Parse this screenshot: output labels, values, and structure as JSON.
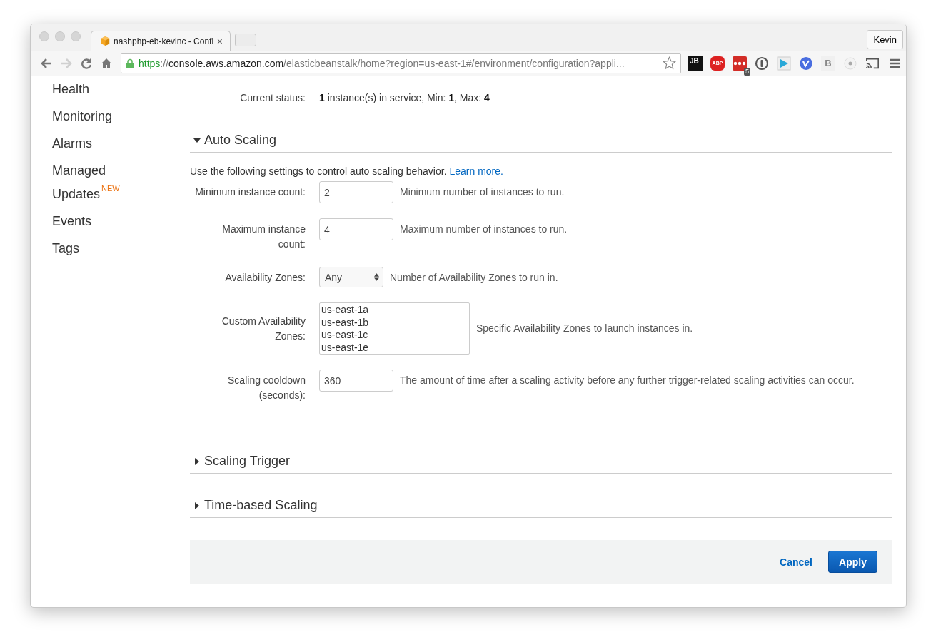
{
  "browser": {
    "tab": {
      "title": "nashphp-eb-kevinc - Confi",
      "close": "×"
    },
    "profile": "Kevin",
    "nav": [
      {
        "kind": "back",
        "disabled": false
      },
      {
        "kind": "forward",
        "disabled": true
      },
      {
        "kind": "reload",
        "disabled": false
      },
      {
        "kind": "home",
        "disabled": false
      }
    ],
    "url": {
      "scheme": "https",
      "sep": "://",
      "host": "console.aws.amazon.com",
      "path": "/elasticbeanstalk/home?region=us-east-1#/environment/configuration?appli..."
    },
    "extensions": [
      {
        "kind": "jb",
        "label": "JB"
      },
      {
        "kind": "abp",
        "label": "ABP"
      },
      {
        "kind": "lastpass",
        "badge": "5"
      },
      {
        "kind": "onepassword"
      },
      {
        "kind": "play"
      },
      {
        "kind": "vimeo"
      },
      {
        "kind": "bi",
        "label": "B"
      },
      {
        "kind": "dot"
      },
      {
        "kind": "cast"
      }
    ]
  },
  "sidebar": {
    "items": [
      {
        "label": "Health"
      },
      {
        "label": "Monitoring"
      },
      {
        "label": "Alarms"
      },
      {
        "label": "Managed Updates",
        "badge": "NEW"
      },
      {
        "label": "Events"
      },
      {
        "label": "Tags"
      }
    ]
  },
  "status": {
    "label": "Current status:",
    "value": "**1** instance(s) in service, Min: **1**, Max: **4**"
  },
  "sections": [
    {
      "title": "Auto Scaling",
      "expanded": true,
      "intro": "Use the following settings to control auto scaling behavior.",
      "link": "Learn more.",
      "fields": [
        {
          "kind": "text",
          "label": "Minimum instance count:",
          "value": "2",
          "help": "Minimum number of instances to run."
        },
        {
          "kind": "text",
          "label": "Maximum instance count:",
          "value": "4",
          "help": "Maximum number of instances to run."
        },
        {
          "kind": "select",
          "label": "Availability Zones:",
          "value": "Any",
          "help": "Number of Availability Zones to run in."
        },
        {
          "kind": "multiselect",
          "label": "Custom Availability Zones:",
          "options": [
            {
              "label": "us-east-1a",
              "selected": false
            },
            {
              "label": "us-east-1b",
              "selected": false
            },
            {
              "label": "us-east-1c",
              "selected": false
            },
            {
              "label": "us-east-1e",
              "selected": false
            }
          ],
          "help": "Specific Availability Zones to launch instances in."
        },
        {
          "kind": "text",
          "label": "Scaling cooldown (seconds):",
          "value": "360",
          "help": "The amount of time after a scaling activity before any further trigger-related scaling activities can occur."
        }
      ]
    },
    {
      "title": "Scaling Trigger",
      "expanded": false
    },
    {
      "title": "Time-based Scaling",
      "expanded": false
    }
  ],
  "footer": {
    "cancel": "Cancel",
    "apply": "Apply"
  }
}
